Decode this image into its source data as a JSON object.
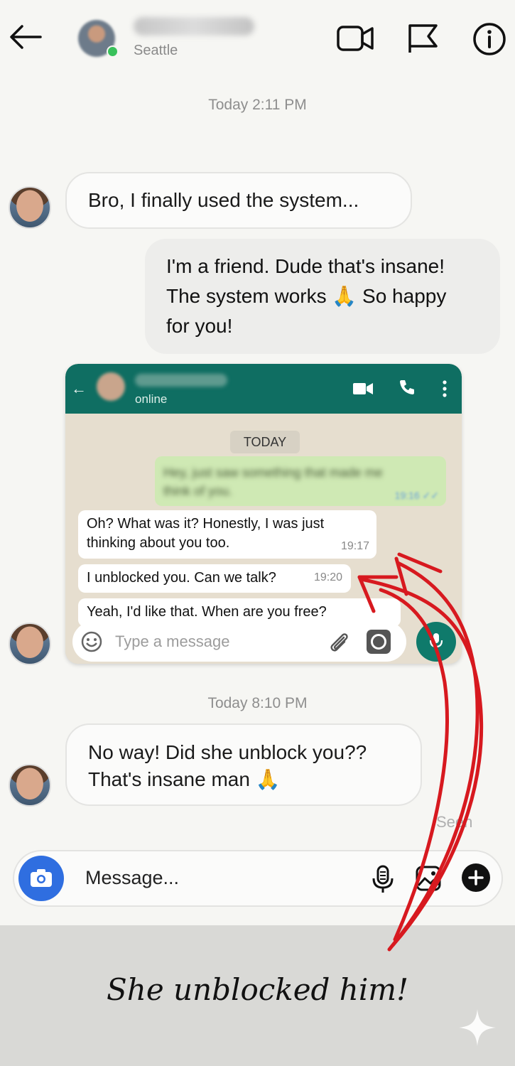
{
  "header": {
    "location": "Seattle"
  },
  "timestamps": {
    "first": "Today 2:11 PM",
    "second": "Today 8:10 PM"
  },
  "messages": {
    "m1": "Bro, I finally used the system...",
    "m2_line1": "I'm a friend. Dude that's insane!",
    "m2_line2": "The system works 🙏 So happy",
    "m2_line3": "for you!",
    "m3_line1": "No way! Did she unblock you??",
    "m3_line2": "That's insane man 🙏"
  },
  "whatsapp": {
    "status": "online",
    "day_label": "TODAY",
    "blurred_line1": "Hey, just saw something that made me",
    "blurred_line2": "think of you.",
    "blurred_time": "19:16 ✓✓",
    "msg1_line1": "Oh? What was it? Honestly, I was just",
    "msg1_line2": "thinking about you too.",
    "msg1_time": "19:17",
    "msg2": "I unblocked you. Can we talk?",
    "msg2_time": "19:20",
    "msg3": "Yeah, I'd like that. When are you free?",
    "input_placeholder": "Type a message"
  },
  "seen_label": "Seen",
  "composer": {
    "placeholder": "Message..."
  },
  "caption": "She unblocked him!",
  "colors": {
    "whatsapp_green": "#0f6e62",
    "arrow_red": "#d7191f",
    "camera_blue": "#2f6ee0"
  },
  "icons": [
    "back-arrow-icon",
    "video-call-icon",
    "flag-icon",
    "info-icon",
    "camera-icon",
    "microphone-icon",
    "gallery-icon",
    "plus-icon",
    "emoji-icon",
    "attach-icon",
    "sparkle-icon"
  ]
}
